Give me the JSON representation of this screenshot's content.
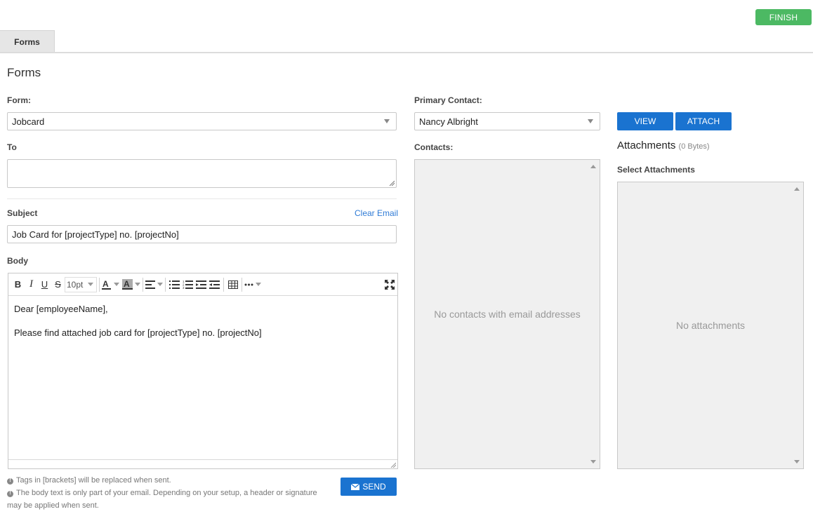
{
  "header": {
    "finish_label": "FINISH",
    "tab_label": "Forms"
  },
  "page": {
    "title": "Forms"
  },
  "form": {
    "label": "Form:",
    "value": "Jobcard"
  },
  "to": {
    "label": "To",
    "value": ""
  },
  "subject": {
    "label": "Subject",
    "clear_link": "Clear Email",
    "value": "Job Card for [projectType] no. [projectNo]"
  },
  "body": {
    "label": "Body",
    "font_size": "10pt",
    "lines": [
      "Dear [employeeName],",
      "Please find attached job card for [projectType] no. [projectNo]"
    ]
  },
  "notes": {
    "tags": "Tags in [brackets] will be replaced when sent.",
    "body_text": "The body text is only part of your email. Depending on your setup, a header or signature may be applied when sent."
  },
  "send_label": "SEND",
  "primary_contact": {
    "label": "Primary Contact:",
    "value": "Nancy Albright"
  },
  "contacts": {
    "label": "Contacts:",
    "empty_text": "No contacts with email addresses"
  },
  "buttons": {
    "view_label": "VIEW",
    "attach_label": "ATTACH"
  },
  "attachments": {
    "title": "Attachments",
    "size": "(0 Bytes)",
    "select_label": "Select Attachments",
    "empty_text": "No attachments"
  },
  "colors": {
    "finish": "#4cb963",
    "primary": "#1a73d0",
    "link": "#2f7bd6"
  }
}
